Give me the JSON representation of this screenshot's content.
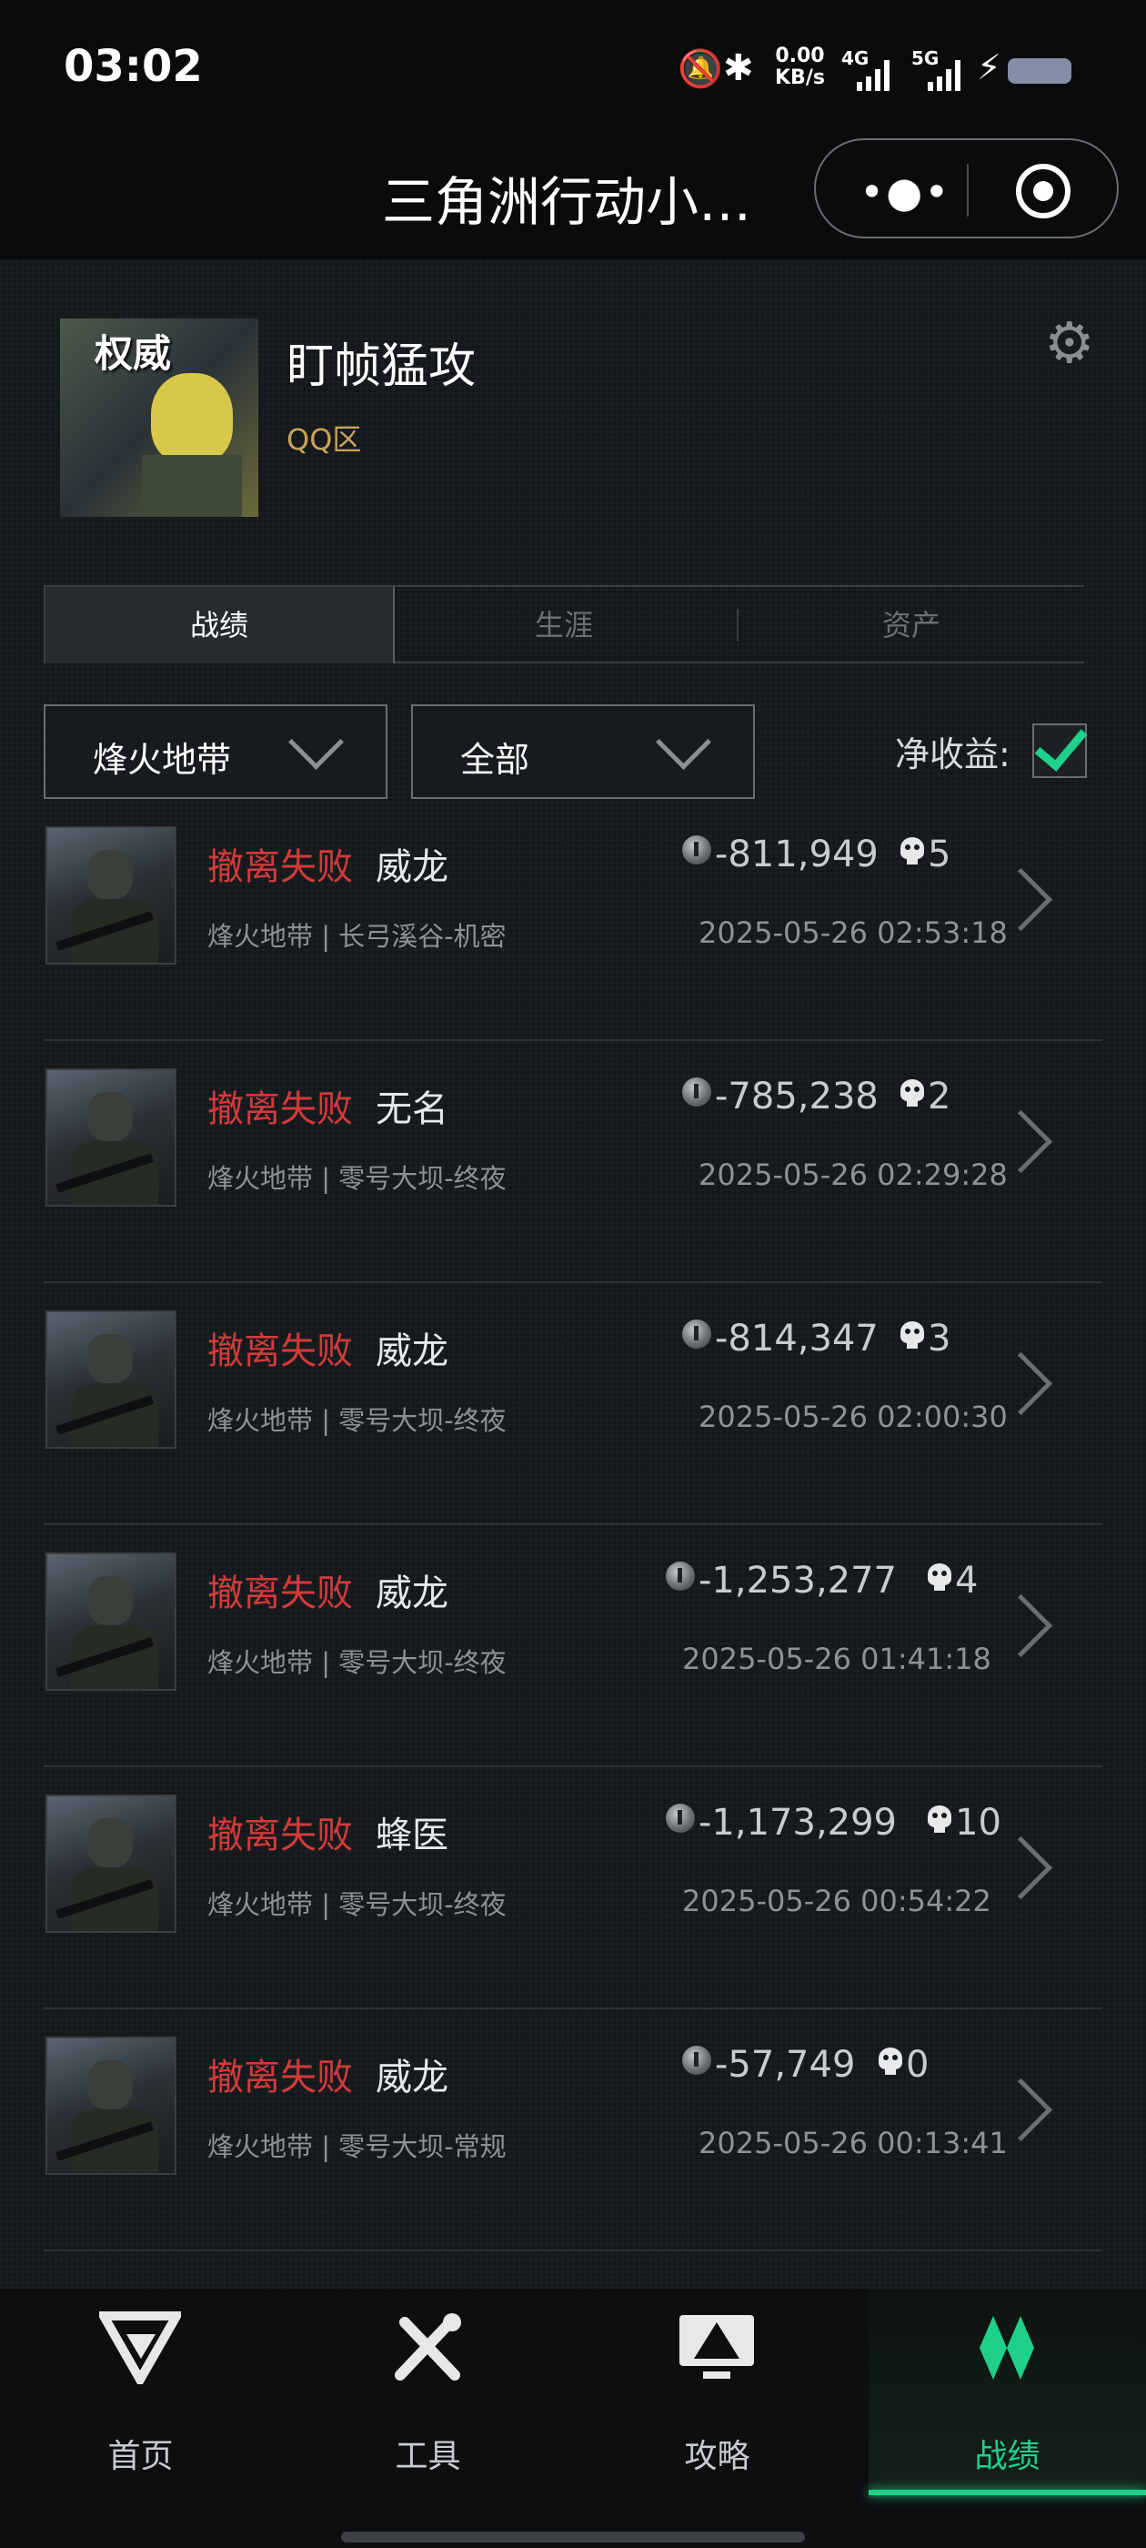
{
  "status_bar": {
    "time": "03:02",
    "net_speed_top": "0.00",
    "net_speed_unit": "KB/s",
    "sim1": "4G",
    "sim2": "5G"
  },
  "header": {
    "title": "三角洲行动小…"
  },
  "profile": {
    "nickname": "盯帧猛攻",
    "region": "QQ区",
    "avatar_text": "权威"
  },
  "tabs": [
    {
      "label": "战绩"
    },
    {
      "label": "生涯"
    },
    {
      "label": "资产"
    }
  ],
  "filters": {
    "mode": "烽火地带",
    "scope": "全部",
    "net_label": "净收益:",
    "net_checked": true
  },
  "records": [
    {
      "status": "撤离失败",
      "operator": "威龙",
      "value": "-811,949",
      "kills": "5",
      "map": "烽火地带 | 长弓溪谷-机密",
      "time": "2025-05-26 02:53:18"
    },
    {
      "status": "撤离失败",
      "operator": "无名",
      "value": "-785,238",
      "kills": "2",
      "map": "烽火地带 | 零号大坝-终夜",
      "time": "2025-05-26 02:29:28"
    },
    {
      "status": "撤离失败",
      "operator": "威龙",
      "value": "-814,347",
      "kills": "3",
      "map": "烽火地带 | 零号大坝-终夜",
      "time": "2025-05-26 02:00:30"
    },
    {
      "status": "撤离失败",
      "operator": "威龙",
      "value": "-1,253,277",
      "kills": "4",
      "map": "烽火地带 | 零号大坝-终夜",
      "time": "2025-05-26 01:41:18"
    },
    {
      "status": "撤离失败",
      "operator": "蜂医",
      "value": "-1,173,299",
      "kills": "10",
      "map": "烽火地带 | 零号大坝-终夜",
      "time": "2025-05-26 00:54:22"
    },
    {
      "status": "撤离失败",
      "operator": "威龙",
      "value": "-57,749",
      "kills": "0",
      "map": "烽火地带 | 零号大坝-常规",
      "time": "2025-05-26 00:13:41"
    }
  ],
  "nav": [
    {
      "label": "首页"
    },
    {
      "label": "工具"
    },
    {
      "label": "攻略"
    },
    {
      "label": "战绩"
    }
  ],
  "colors": {
    "accent": "#1fd08a",
    "fail": "#d23b3b",
    "region": "#c9a35a"
  }
}
